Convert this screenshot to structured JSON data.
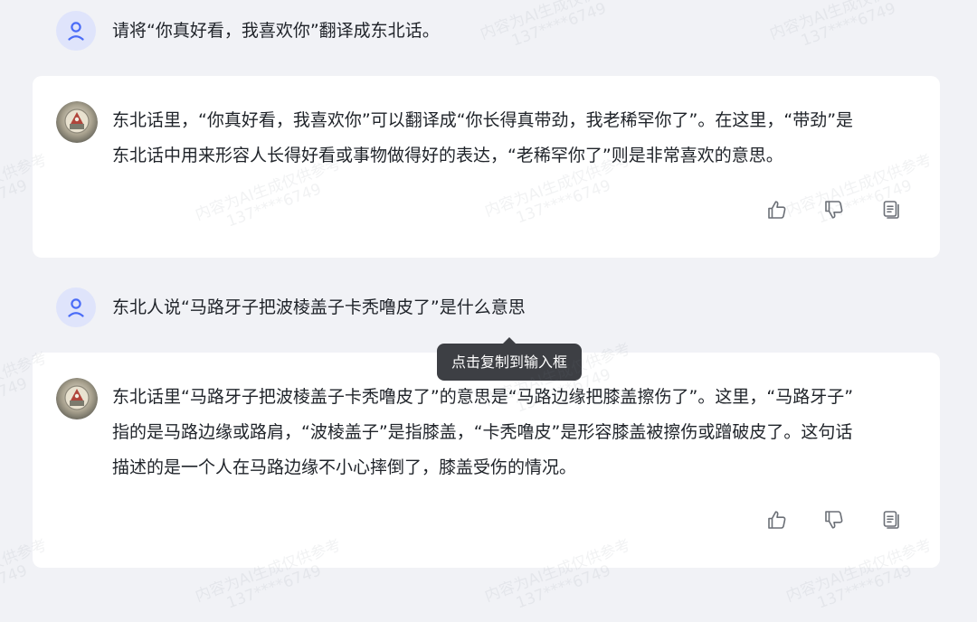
{
  "conversation": [
    {
      "role": "user",
      "text": "请将“你真好看，我喜欢你”翻译成东北话。"
    },
    {
      "role": "assistant",
      "lines": [
        "东北话里，“你真好看，我喜欢你”可以翻译成“你长得真带劲，我老稀罕你了”。在这里，“带劲”是",
        "东北话中用来形容人长得好看或事物做得好的表达，“老稀罕你了”则是非常喜欢的意思。"
      ]
    },
    {
      "role": "user",
      "text": "东北人说“马路牙子把波棱盖子卡秃噜皮了”是什么意思"
    },
    {
      "role": "assistant",
      "lines": [
        "东北话里“马路牙子把波棱盖子卡秃噜皮了”的意思是“马路边缘把膝盖擦伤了”。这里，“马路牙子”",
        "指的是马路边缘或路肩，“波棱盖子”是指膝盖，“卡秃噜皮”是形容膝盖被擦伤或蹭破皮了。这句话",
        "描述的是一个人在马路边缘不小心摔倒了，膝盖受伤的情况。"
      ]
    }
  ],
  "tooltip": "点击复制到输入框",
  "icons": {
    "user_avatar": "user-icon",
    "bot_avatar": "bot-avatar-emblem",
    "like": "thumbs-up-icon",
    "dislike": "thumbs-down-icon",
    "copy": "copy-icon"
  },
  "watermark": {
    "line1": "内容为AI生成仅供参考",
    "line2": "137****6749"
  },
  "colors": {
    "background": "#f1f2f6",
    "card": "#ffffff",
    "user_avatar_bg": "#dfe4fb",
    "user_icon": "#4a6cf7",
    "tooltip_bg": "#3d3f44",
    "text": "#1f2329",
    "icon_gray": "#6b6f76"
  }
}
